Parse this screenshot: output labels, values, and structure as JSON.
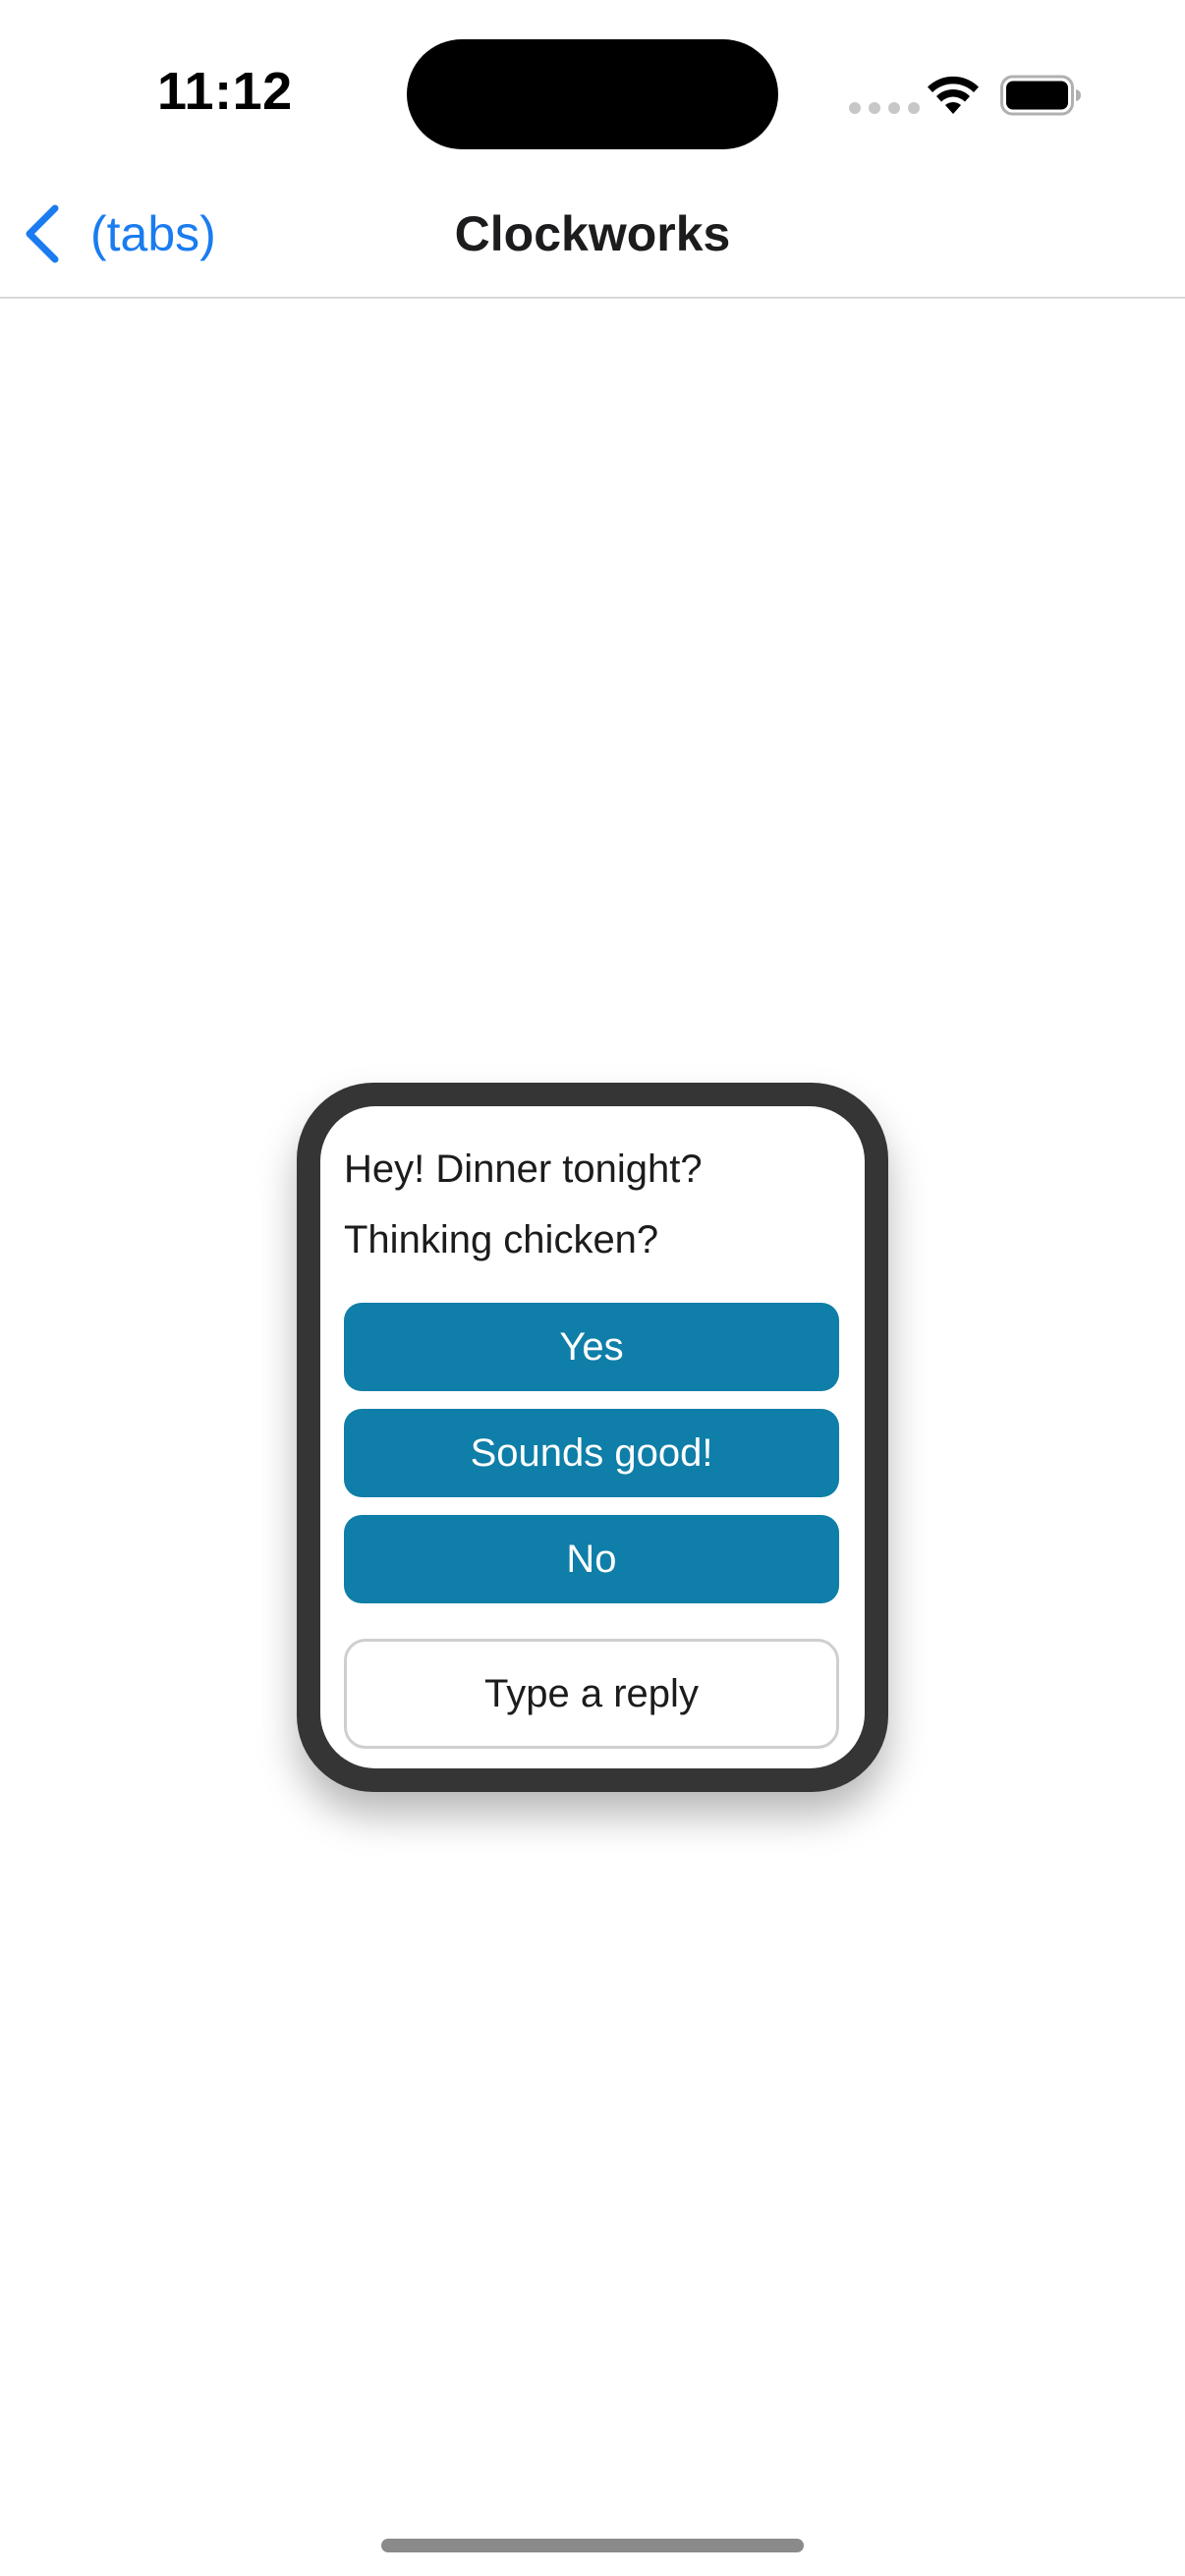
{
  "status_bar": {
    "time": "11:12",
    "icons": [
      "cellular-signal-icon",
      "wifi-icon",
      "battery-icon"
    ]
  },
  "nav": {
    "back_label": "(tabs)",
    "title": "Clockworks",
    "back_icon": "chevron-left-icon"
  },
  "watch": {
    "message_lines": [
      "Hey! Dinner tonight?",
      "Thinking chicken?"
    ],
    "replies": [
      "Yes",
      "Sounds good!",
      "No"
    ],
    "type_reply_label": "Type a reply"
  },
  "colors": {
    "accent": "#1a7cf0",
    "reply_button": "#0f7ea8",
    "watch_frame": "#353535"
  }
}
